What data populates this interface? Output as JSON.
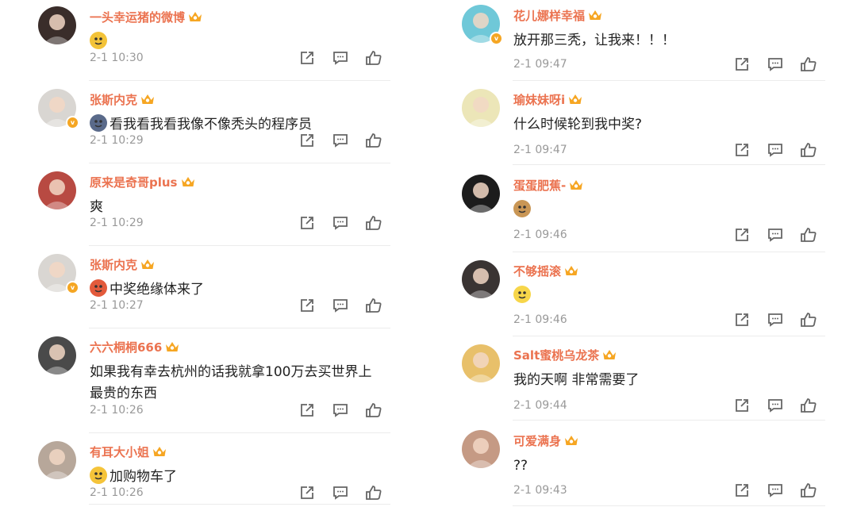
{
  "left": [
    {
      "name": "一头幸运猪的微博",
      "text": "",
      "emoji": "bee",
      "time": "2-1 10:30",
      "verified": false,
      "avatar": "#3a2d2a"
    },
    {
      "name": "张斯内克",
      "text": "看我看我看我像不像秃头的程序员",
      "emoji": "owl",
      "time": "2-1 10:29",
      "verified": true,
      "avatar": "#d9d6d2"
    },
    {
      "name": "原来是奇哥plus",
      "text": "爽",
      "emoji": "",
      "time": "2-1 10:29",
      "verified": false,
      "avatar": "#b84a42"
    },
    {
      "name": "张斯内克",
      "text": "中奖绝缘体来了",
      "emoji": "crab",
      "time": "2-1 10:27",
      "verified": true,
      "avatar": "#d9d6d2"
    },
    {
      "name": "六六桐桐666",
      "text": "如果我有幸去杭州的话我就拿100万去买世界上最贵的东西",
      "emoji": "",
      "time": "2-1 10:26",
      "verified": false,
      "avatar": "#4a4a4a"
    },
    {
      "name": "有耳大小姐",
      "text": "加购物车了",
      "emoji": "scared",
      "time": "2-1 10:26",
      "verified": false,
      "avatar": "#b7a79a"
    }
  ],
  "right": [
    {
      "name": "花儿娜样幸福",
      "text": "放开那三秃，让我来！！！",
      "emoji": "",
      "time": "2-1 09:47",
      "verified": true,
      "avatar": "#6fc8d8"
    },
    {
      "name": "瑜妹妹呀i",
      "text": "什么时候轮到我中奖?",
      "emoji": "",
      "time": "2-1 09:47",
      "verified": false,
      "avatar": "#ece6b8"
    },
    {
      "name": "蛋蛋肥蕉-",
      "text": "",
      "emoji": "monkey",
      "time": "2-1 09:46",
      "verified": false,
      "avatar": "#1c1c1c"
    },
    {
      "name": "不够摇滚",
      "text": "",
      "emoji": "lemon",
      "time": "2-1 09:46",
      "verified": false,
      "avatar": "#3a3433"
    },
    {
      "name": "Salt蜜桃乌龙茶",
      "text": "我的天啊 非常需要了",
      "emoji": "",
      "time": "2-1 09:44",
      "verified": false,
      "avatar": "#e8c06a"
    },
    {
      "name": "可爱满身",
      "text": "??",
      "emoji": "",
      "time": "2-1 09:43",
      "verified": false,
      "avatar": "#c59a84"
    }
  ],
  "icons": {
    "share": "share-icon",
    "comment": "comment-icon",
    "like": "like-icon"
  },
  "colors": {
    "name": "#eb7350",
    "time": "#999999",
    "text": "#222222",
    "divider": "#ececec"
  }
}
